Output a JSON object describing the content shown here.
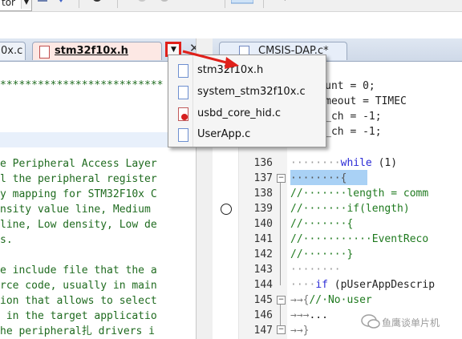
{
  "toolbar": {
    "combo_value": "tor"
  },
  "left_tabs": [
    {
      "label": "0x.c"
    },
    {
      "label": "stm32f10x.h"
    }
  ],
  "left_close": "✕",
  "dropdown_button": "▼",
  "left_code": [
    "**************************",
    "",
    "",
    "",
    "e Peripheral Access Layer",
    "l the peripheral register",
    "y mapping for STM32F10x C",
    "nsity value line, Medium ",
    "line, Low density, Low de",
    "s.",
    "",
    "e include file that the a",
    "rce code, usually in main",
    "ion that allows to select",
    " in the target applicatio",
    "he peripheral扎 drivers i"
  ],
  "right_tabs": [
    {
      "label": "CMSIS-DAP.c*"
    }
  ],
  "menu_items": [
    {
      "label": "stm32f10x.h",
      "icon": "header-file-icon"
    },
    {
      "label": "system_stm32f10x.c",
      "icon": "source-file-icon"
    },
    {
      "label": "usbd_core_hid.c",
      "icon": "readonly-file-icon"
    },
    {
      "label": "UserApp.c",
      "icon": "source-file-icon"
    }
  ],
  "right_top_lines": [
    "ed_count = 0;",
    "ed_timeout = TIMEC",
    "sb_rx_ch = -1;",
    "sb_tx_ch = -1;"
  ],
  "line_numbers": [
    "136",
    "137",
    "138",
    "139",
    "140",
    "141",
    "142",
    "143",
    "144",
    "145",
    "146",
    "147"
  ],
  "code_lines": [
    {
      "pre": "········",
      "kw": "while",
      "post": " (1)"
    },
    {
      "pre": "········{",
      "kw": "",
      "post": ""
    },
    {
      "cm": "//·······length = comm"
    },
    {
      "cm": "//·······if(length)"
    },
    {
      "cm": "//·······{"
    },
    {
      "cm": "//···········EventReco"
    },
    {
      "cm": "//·······}"
    },
    {
      "pre": "········",
      "kw": "",
      "post": ""
    },
    {
      "pre": "····",
      "kw": "if",
      "post": " (pUserAppDescrip"
    },
    {
      "pre": "→→{",
      "kw": "",
      "post": "",
      "cm2": "//·No·user"
    },
    {
      "pre": "→→→",
      "kw": "",
      "post": "...",
      "cm2": ""
    },
    {
      "pre": "→→}",
      "kw": "",
      "post": "",
      "cm2": ""
    }
  ],
  "watermark": "鱼鹰谈单片机"
}
